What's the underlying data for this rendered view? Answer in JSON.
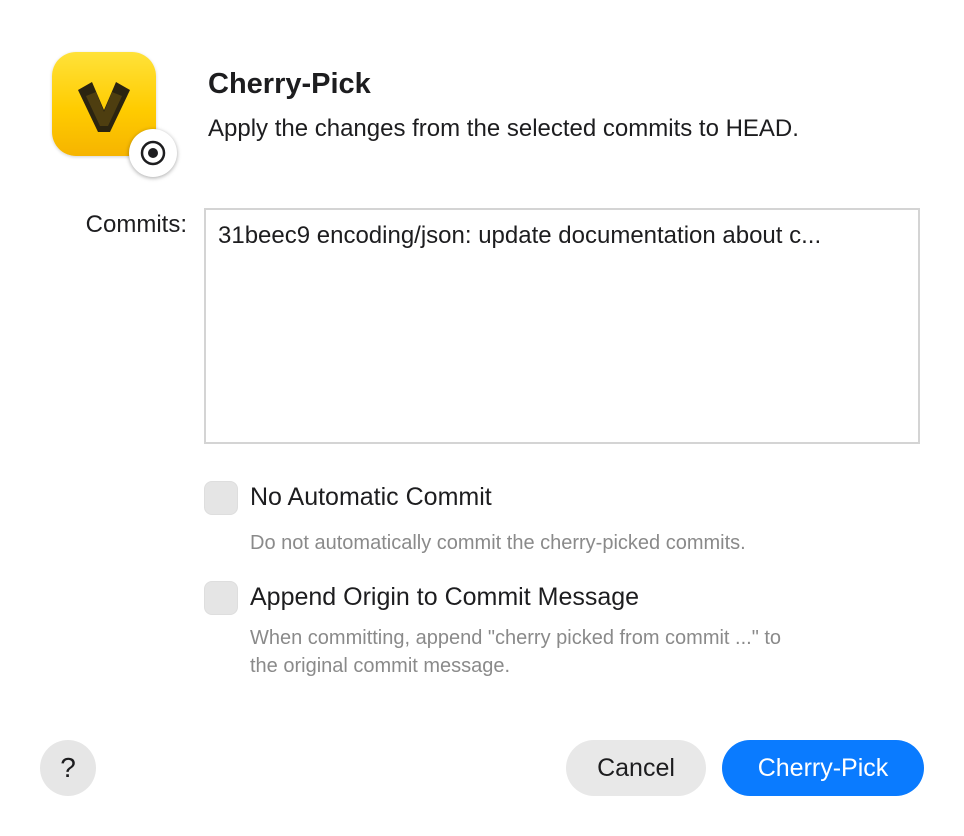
{
  "dialog": {
    "title": "Cherry-Pick",
    "subtitle": "Apply the changes from the selected commits to HEAD.",
    "app_icon": "fork-app-icon",
    "badge_icon": "cherry-pick-icon",
    "colors": {
      "accent": "#0a7bff",
      "icon_yellow": "#ffcc00"
    }
  },
  "commits": {
    "label": "Commits:",
    "items": [
      {
        "text": "31beec9 encoding/json: update documentation about c..."
      }
    ]
  },
  "options": [
    {
      "label": "No Automatic Commit",
      "description": "Do not automatically commit the cherry-picked commits.",
      "checked": false
    },
    {
      "label": "Append Origin to Commit Message",
      "description_lines": [
        "When committing, append \"cherry picked from commit ...\" to",
        "the original commit message."
      ],
      "checked": false
    }
  ],
  "buttons": {
    "help": "?",
    "cancel": "Cancel",
    "confirm": "Cherry-Pick"
  }
}
